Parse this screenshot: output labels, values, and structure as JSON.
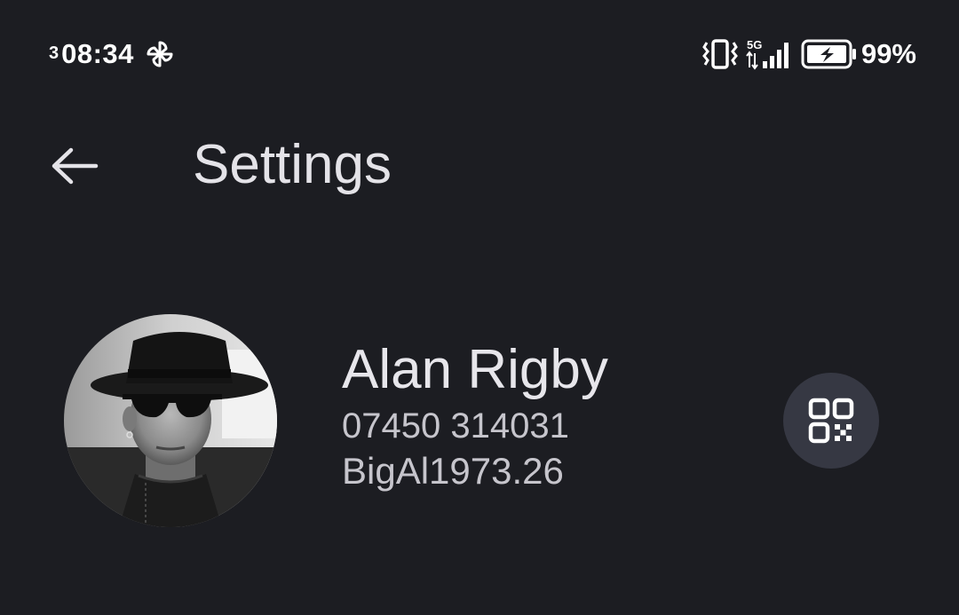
{
  "status_bar": {
    "notification_count": "3",
    "time": "08:34",
    "network": "5G",
    "battery_percent": "99%",
    "icons": [
      "pinwheel-icon",
      "vibrate-icon",
      "signal-icon",
      "battery-charging-icon"
    ]
  },
  "app_bar": {
    "back_icon": "arrow-back-icon",
    "title": "Settings"
  },
  "profile": {
    "name": "Alan Rigby",
    "phone": "07450 314031",
    "username": "BigAl1973.26",
    "qr_icon": "qr-code-icon"
  },
  "colors": {
    "background": "#1c1d22",
    "primary_text": "#e4e3e8",
    "secondary_text": "#c6c5cc",
    "qr_button_bg": "#363843"
  }
}
